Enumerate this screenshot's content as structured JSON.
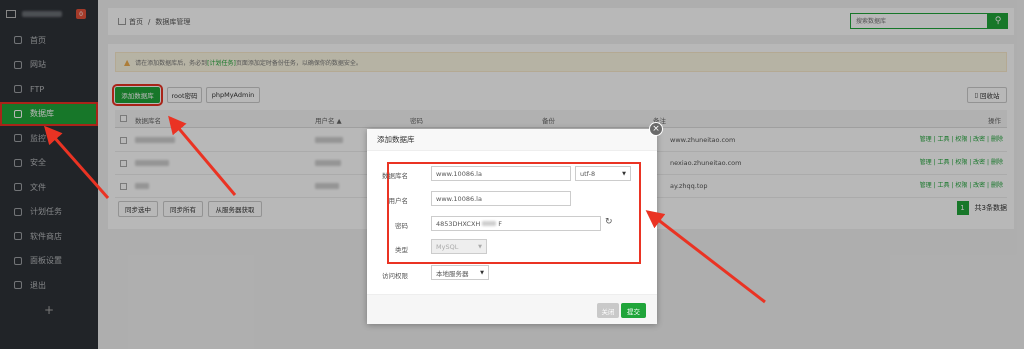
{
  "sidebar": {
    "badge": "0",
    "items": [
      {
        "label": "首页",
        "icon": "home-icon"
      },
      {
        "label": "网站",
        "icon": "globe-icon"
      },
      {
        "label": "FTP",
        "icon": "ftp-icon"
      },
      {
        "label": "数据库",
        "icon": "database-icon",
        "active": true
      },
      {
        "label": "监控",
        "icon": "monitor-icon"
      },
      {
        "label": "安全",
        "icon": "shield-icon"
      },
      {
        "label": "文件",
        "icon": "folder-icon"
      },
      {
        "label": "计划任务",
        "icon": "clock-icon"
      },
      {
        "label": "软件商店",
        "icon": "grid-icon"
      },
      {
        "label": "面板设置",
        "icon": "gear-icon"
      },
      {
        "label": "退出",
        "icon": "logout-icon"
      }
    ],
    "plus": "+"
  },
  "breadcrumb": {
    "home": "首页",
    "sep": "/",
    "current": "数据库管理"
  },
  "search": {
    "placeholder": "搜索数据库"
  },
  "notice": {
    "prefix": "请在添加数据库后，务必到",
    "link": "[计划任务]",
    "suffix": "页面添加定时备份任务，以确保你的数据安全。"
  },
  "toolbar": {
    "add": "添加数据库",
    "root_pwd": "root密码",
    "phpmyadmin": "phpMyAdmin",
    "recycle": "回收站"
  },
  "table": {
    "headers": {
      "name": "数据库名",
      "user": "用户名 ▲",
      "password": "密码",
      "backup": "备份",
      "note": "备注",
      "ops": "操作"
    },
    "rows": [
      {
        "note": "www.zhuneitao.com",
        "ops": "管理 | 工具 | 权限 | 改密 | 删除"
      },
      {
        "note": "nexiao.zhuneitao.com",
        "ops": "管理 | 工具 | 权限 | 改密 | 删除"
      },
      {
        "note": "ay.zhqq.top",
        "ops": "管理 | 工具 | 权限 | 改密 | 删除"
      }
    ]
  },
  "footer": {
    "sync_sel": "同步选中",
    "sync_all": "同步所有",
    "from_server": "从服务器获取",
    "page": "1",
    "total": "共3条数据"
  },
  "dialog": {
    "title": "添加数据库",
    "close_icon": "×",
    "labels": {
      "dbname": "数据库名",
      "user": "用户名",
      "password": "密码",
      "type": "类型",
      "access": "访问权限"
    },
    "values": {
      "dbname": "www.10086.la",
      "charset": "utf-8",
      "user": "www.10086.la",
      "password": "4853DHXCXH",
      "password_tail": "F",
      "type": "MySQL",
      "access": "本地服务器"
    },
    "buttons": {
      "close": "关闭",
      "submit": "提交"
    }
  },
  "colors": {
    "accent": "#20a53a",
    "annotation": "#ea3323"
  }
}
